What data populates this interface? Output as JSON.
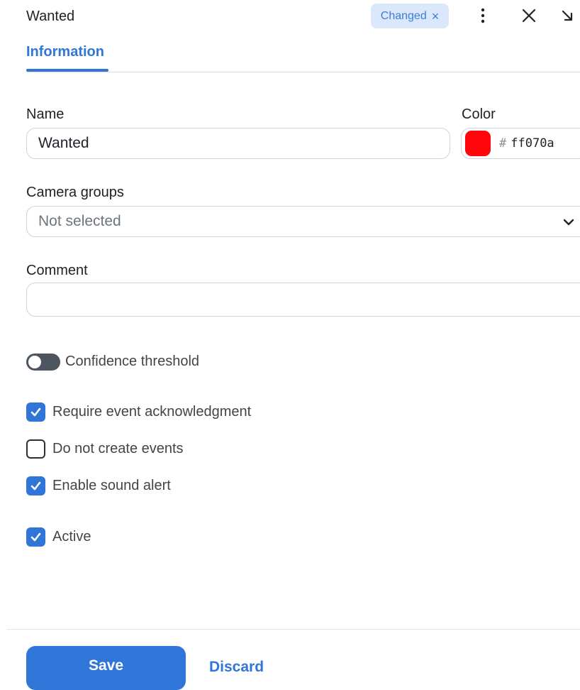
{
  "header": {
    "title": "Wanted",
    "badge_label": "Changed",
    "badge_close_glyph": "×",
    "icons": {
      "menu": "kebab-menu-icon",
      "close": "close-icon",
      "collapse": "collapse-arrow-icon"
    }
  },
  "tabs": [
    {
      "label": "Information",
      "active": true
    }
  ],
  "form": {
    "name_label": "Name",
    "name_value": "Wanted",
    "color_label": "Color",
    "color_hash": "#",
    "color_value": "ff070a",
    "color_swatch": "#ff070a",
    "camera_groups_label": "Camera groups",
    "camera_groups_value": "Not selected",
    "comment_label": "Comment",
    "comment_value": "",
    "confidence_threshold_label": "Confidence threshold",
    "confidence_threshold_enabled": false,
    "checkboxes": [
      {
        "label": "Require event acknowledgment",
        "checked": true
      },
      {
        "label": "Do not create events",
        "checked": false
      },
      {
        "label": "Enable sound alert",
        "checked": true
      },
      {
        "label": "Active",
        "checked": true
      }
    ]
  },
  "footer": {
    "save_label": "Save",
    "discard_label": "Discard"
  },
  "colors": {
    "accent": "#2f76d8",
    "badge_bg": "#dbe8fb",
    "toggle_off": "#4d5560"
  }
}
